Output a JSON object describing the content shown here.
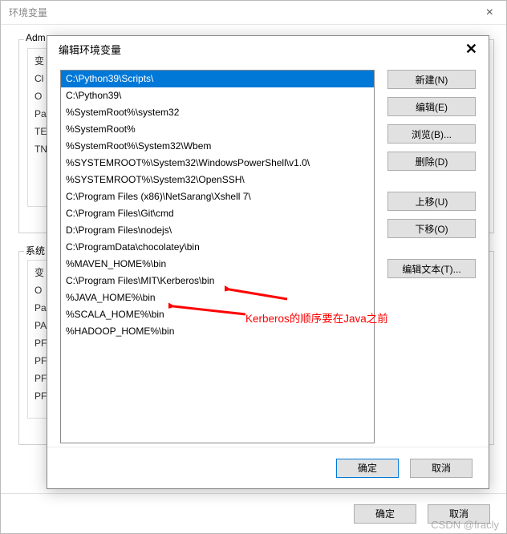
{
  "outer": {
    "title": "环境变量",
    "close_glyph": "×",
    "group1_label": "Adm",
    "group2_label": "系统",
    "list1_stub": [
      "变",
      "Cl",
      "O",
      "Pa",
      "TE",
      "TN"
    ],
    "list2_stub": [
      "变",
      "O",
      "Pa",
      "PA",
      "PF",
      "PF",
      "PF",
      "PF"
    ],
    "footer": {
      "ok": "确定",
      "cancel": "取消"
    }
  },
  "inner": {
    "title": "编辑环境变量",
    "close_glyph": "✕",
    "paths": [
      "C:\\Python39\\Scripts\\",
      "C:\\Python39\\",
      "%SystemRoot%\\system32",
      "%SystemRoot%",
      "%SystemRoot%\\System32\\Wbem",
      "%SYSTEMROOT%\\System32\\WindowsPowerShell\\v1.0\\",
      "%SYSTEMROOT%\\System32\\OpenSSH\\",
      "C:\\Program Files (x86)\\NetSarang\\Xshell 7\\",
      "C:\\Program Files\\Git\\cmd",
      "D:\\Program Files\\nodejs\\",
      "C:\\ProgramData\\chocolatey\\bin",
      "%MAVEN_HOME%\\bin",
      "C:\\Program Files\\MIT\\Kerberos\\bin",
      "%JAVA_HOME%\\bin",
      "%SCALA_HOME%\\bin",
      "%HADOOP_HOME%\\bin"
    ],
    "selected_index": 0,
    "buttons": {
      "new": "新建(N)",
      "edit": "编辑(E)",
      "browse": "浏览(B)...",
      "delete": "删除(D)",
      "moveup": "上移(U)",
      "movedown": "下移(O)",
      "edit_text": "编辑文本(T)..."
    },
    "footer": {
      "ok": "确定",
      "cancel": "取消"
    }
  },
  "annotation": {
    "text": "Kerberos的顺序要在Java之前"
  },
  "watermark": "CSDN @fracly"
}
